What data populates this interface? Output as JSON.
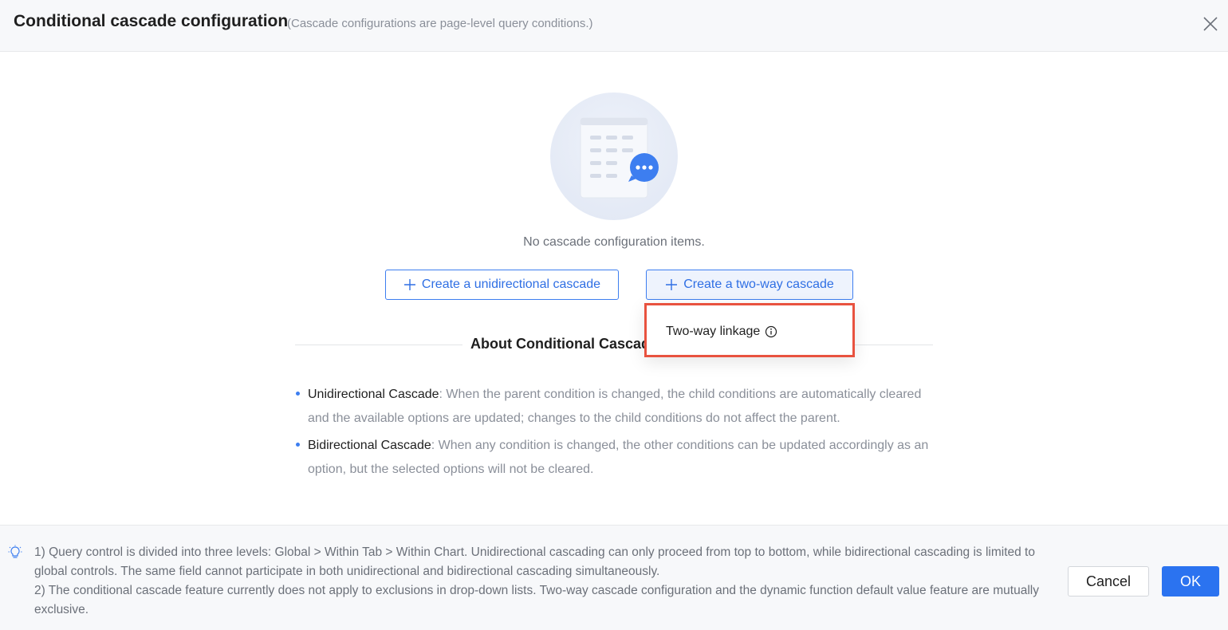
{
  "dialog": {
    "title": "Conditional cascade configuration",
    "subtitle": "(Cascade configurations are page-level query conditions.)",
    "close_icon": "close-icon"
  },
  "empty_state": {
    "illustration_icon": "document-chat-icon",
    "message": "No cascade configuration items."
  },
  "actions": {
    "create_unidirectional_label": "Create a unidirectional cascade",
    "create_two_way_label": "Create a two-way cascade"
  },
  "dropdown": {
    "items": [
      {
        "label": "Two-way linkage",
        "icon": "info-icon"
      }
    ]
  },
  "about": {
    "title": "About Conditional Cascade",
    "bullets": [
      {
        "term": "Unidirectional Cascade",
        "description": ": When the parent condition is changed, the child conditions are automatically cleared and the available options are updated; changes to the child conditions do not affect the parent."
      },
      {
        "term": "Bidirectional Cascade",
        "description": ": When any condition is changed, the other conditions can be updated accordingly as an option, but the selected options will not be cleared."
      }
    ]
  },
  "footer": {
    "tip_icon": "lightbulb-icon",
    "notes": [
      "1) Query control is divided into three levels: Global > Within Tab > Within Chart. Unidirectional cascading can only proceed from top to bottom, while bidirectional cascading is limited to global controls. The same field cannot participate in both unidirectional and bidirectional cascading simultaneously.",
      "2) The conditional cascade feature currently does not apply to exclusions in drop-down lists. Two-way cascade configuration and the dynamic function default value feature are mutually exclusive."
    ],
    "cancel_label": "Cancel",
    "ok_label": "OK"
  },
  "colors": {
    "accent": "#2b73f0",
    "highlight_border": "#e8523f",
    "muted_text": "#8a8f99"
  }
}
